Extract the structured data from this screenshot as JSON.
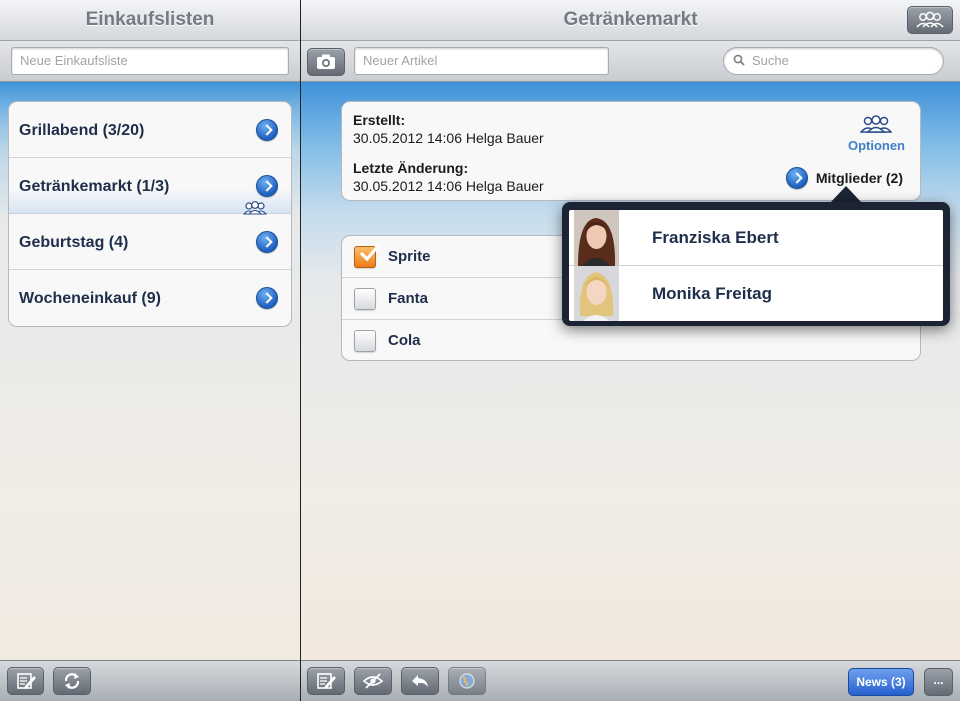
{
  "left_panel": {
    "title": "Einkaufslisten",
    "new_list_placeholder": "Neue Einkaufsliste",
    "lists": [
      {
        "label": "Grillabend (3/20)",
        "shared": false
      },
      {
        "label": "Getränkemarkt (1/3)",
        "shared": true
      },
      {
        "label": "Geburtstag (4)",
        "shared": false
      },
      {
        "label": "Wocheneinkauf (9)",
        "shared": false
      }
    ],
    "toolbar_icons": [
      "edit-icon",
      "refresh-icon"
    ]
  },
  "right_panel": {
    "title": "Getränkemarkt",
    "new_item_placeholder": "Neuer Artikel",
    "search_placeholder": "Suche",
    "info": {
      "created_label": "Erstellt:",
      "created_value": "30.05.2012 14:06 Helga Bauer",
      "modified_label": "Letzte Änderung:",
      "modified_value": "30.05.2012 14:06 Helga Bauer",
      "options_label": "Optionen",
      "members_label": "Mitglieder (2)"
    },
    "items": [
      {
        "label": "Sprite",
        "checked": true
      },
      {
        "label": "Fanta",
        "checked": false
      },
      {
        "label": "Cola",
        "checked": false
      }
    ],
    "members": [
      {
        "name": "Franziska Ebert"
      },
      {
        "name": "Monika Freitag"
      }
    ],
    "toolbar": {
      "icons": [
        "edit-icon",
        "hide-checked-icon",
        "undo-icon",
        "globe-icon"
      ],
      "news_label": "News (3)",
      "more_label": "..."
    }
  },
  "colors": {
    "accent_blue": "#2660cf",
    "checkbox_orange": "#ee7d18",
    "link_blue": "#3f80c8"
  }
}
